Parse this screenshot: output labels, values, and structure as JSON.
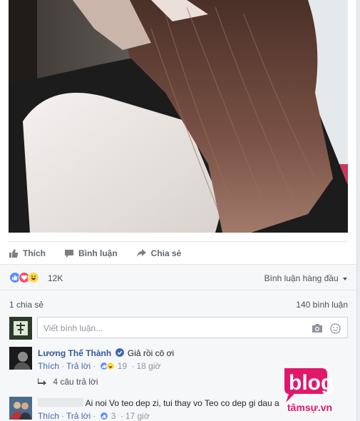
{
  "actions": {
    "like": "Thích",
    "comment": "Bình luận",
    "share": "Chia sẻ"
  },
  "reactions": {
    "count": "12K",
    "types": [
      "like",
      "love",
      "haha"
    ],
    "sort_label": "Bình luận hàng đầu"
  },
  "stats": {
    "shares": "1 chia sẻ",
    "comments": "140 bình luận"
  },
  "composer": {
    "placeholder": "Viết bình luận..."
  },
  "comments": [
    {
      "author": "Lương Thế Thành",
      "verified": true,
      "text": "Giả rồi cô ơi",
      "like": "Thích",
      "reply": "Trả lời",
      "reaction_count": "19",
      "time": "18 giờ",
      "replies": "4 câu trả lời"
    },
    {
      "author": "",
      "text": "Ai noi Vo teo dep zi, tui thay vo Teo co dep gi dau a",
      "like": "Thích",
      "reply": "Trả lời",
      "reaction_count": "3",
      "time": "17 giờ"
    }
  ],
  "watermark": {
    "main": "blog",
    "sub": "tâmsự.vn"
  },
  "colors": {
    "link": "#365899",
    "action": "#616770",
    "brand_pink": "#e0186c",
    "like_blue": "#5890ff",
    "love_red": "#f25268",
    "haha_yellow": "#fcd845"
  }
}
